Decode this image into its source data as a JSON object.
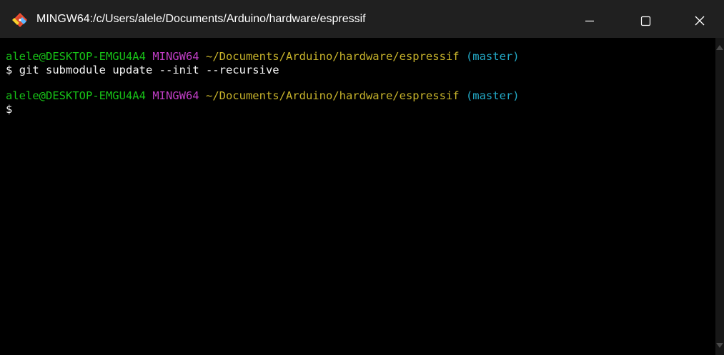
{
  "window": {
    "title": "MINGW64:/c/Users/alele/Documents/Arduino/hardware/espressif",
    "icon": "git-bash-icon",
    "controls": {
      "minimize": "minimize-icon",
      "maximize": "maximize-icon",
      "close": "close-icon"
    }
  },
  "terminal": {
    "lines": [
      {
        "user": "alele@DESKTOP-EMGU4A4",
        "system": "MINGW64",
        "path": "~/Documents/Arduino/hardware/espressif",
        "branch": "(master)"
      },
      {
        "prompt": "$",
        "command": "git submodule update --init --recursive"
      },
      {
        "user": "alele@DESKTOP-EMGU4A4",
        "system": "MINGW64",
        "path": "~/Documents/Arduino/hardware/espressif",
        "branch": "(master)"
      },
      {
        "prompt": "$",
        "command": ""
      }
    ]
  },
  "colors": {
    "titlebar": "#202020",
    "background": "#000000",
    "user": "#17c317",
    "system": "#c13ec6",
    "path": "#c8b42b",
    "branch": "#23a9c6",
    "text": "#f5f5f5"
  }
}
